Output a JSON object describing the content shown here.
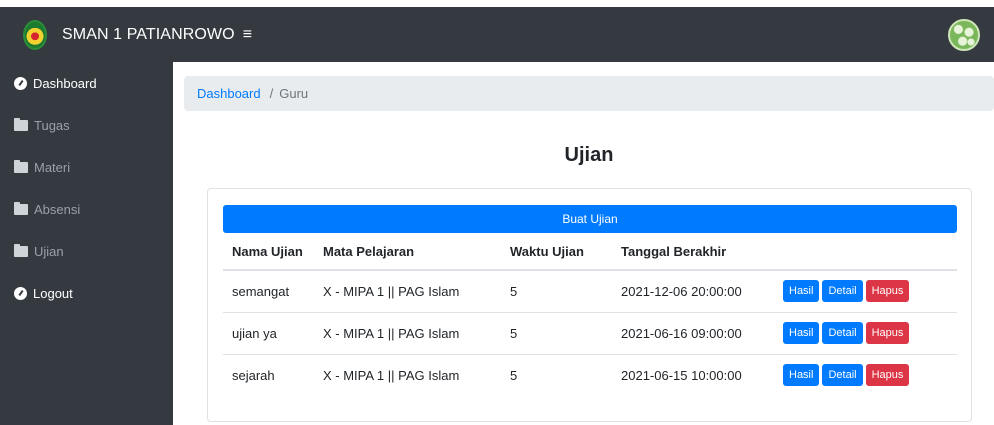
{
  "header": {
    "brand": "SMAN 1 PATIANROWO",
    "menu_toggle": "≡"
  },
  "sidebar": {
    "items": [
      {
        "label": "Dashboard",
        "icon": "dashboard-icon"
      },
      {
        "label": "Tugas",
        "icon": "folder-icon"
      },
      {
        "label": "Materi",
        "icon": "folder-icon"
      },
      {
        "label": "Absensi",
        "icon": "folder-icon"
      },
      {
        "label": "Ujian",
        "icon": "folder-icon"
      },
      {
        "label": "Logout",
        "icon": "dashboard-icon"
      }
    ]
  },
  "breadcrumb": {
    "link": "Dashboard",
    "separator": "/",
    "current": "Guru"
  },
  "page": {
    "title": "Ujian",
    "create_button": "Buat Ujian"
  },
  "table": {
    "headers": [
      "Nama Ujian",
      "Mata Pelajaran",
      "Waktu Ujian",
      "Tanggal Berakhir"
    ],
    "rows": [
      {
        "nama": "semangat",
        "mapel": "X - MIPA 1 || PAG Islam",
        "waktu": "5",
        "tanggal": "2021-12-06 20:00:00"
      },
      {
        "nama": "ujian ya",
        "mapel": "X - MIPA 1 || PAG Islam",
        "waktu": "5",
        "tanggal": "2021-06-16 09:00:00"
      },
      {
        "nama": "sejarah",
        "mapel": "X - MIPA 1 || PAG Islam",
        "waktu": "5",
        "tanggal": "2021-06-15 10:00:00"
      }
    ],
    "actions": {
      "hasil": "Hasil",
      "detail": "Detail",
      "hapus": "Hapus"
    }
  },
  "colors": {
    "topbar": "#343a40",
    "primary": "#007bff",
    "danger": "#dc3545",
    "breadcrumb_bg": "#e9ecef"
  }
}
